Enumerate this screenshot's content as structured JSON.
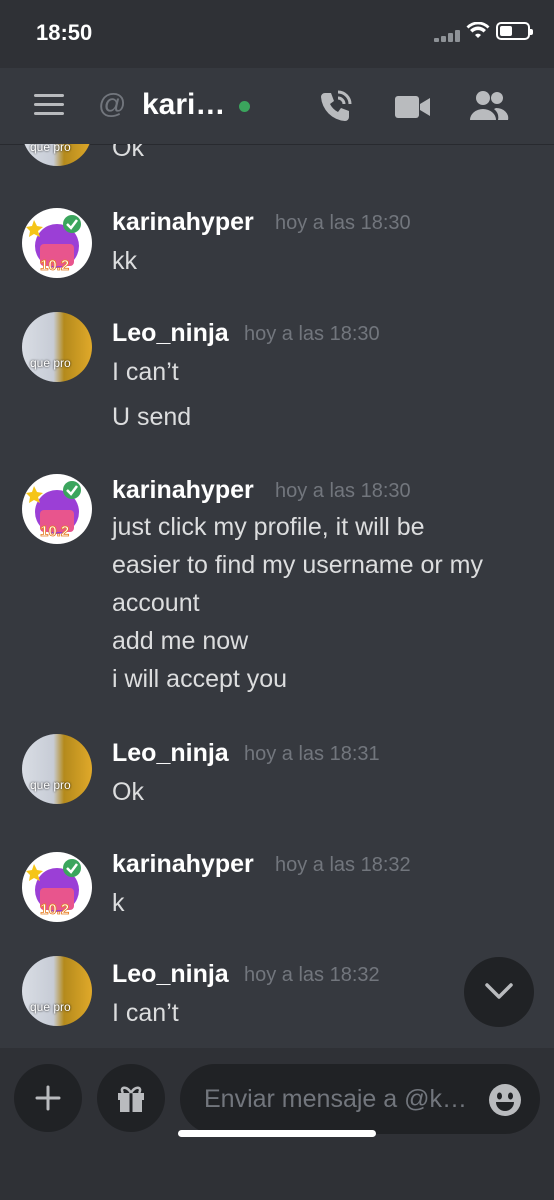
{
  "status_bar": {
    "time": "18:50"
  },
  "header": {
    "at_symbol": "@",
    "channel_name": "kari…",
    "online_color": "#3ba55d",
    "icons": [
      "menu-icon",
      "call-icon",
      "video-icon",
      "members-icon"
    ]
  },
  "messages": [
    {
      "author": "",
      "timestamp": "",
      "lines": [
        "Ok"
      ],
      "avatar_label": "que pro"
    },
    {
      "author": "karinahyper",
      "timestamp": "hoy a las 18:30",
      "lines": [
        "kk"
      ],
      "avatar_label": "10.2"
    },
    {
      "author": "Leo_ninja",
      "timestamp": "hoy a las 18:30",
      "lines": [
        "I can’t",
        "U send"
      ],
      "avatar_label": "que pro"
    },
    {
      "author": "karinahyper",
      "timestamp": "hoy a las 18:30",
      "lines": [
        "just click my profile, it will be",
        "easier to find my username or my",
        "account",
        "add me now",
        "i will accept you"
      ],
      "avatar_label": "10.2"
    },
    {
      "author": "Leo_ninja",
      "timestamp": "hoy a las 18:31",
      "lines": [
        "Ok"
      ],
      "avatar_label": "que pro"
    },
    {
      "author": "karinahyper",
      "timestamp": "hoy a las 18:32",
      "lines": [
        "k"
      ],
      "avatar_label": "10.2"
    },
    {
      "author": "Leo_ninja",
      "timestamp": "hoy a las 18:32",
      "lines": [
        "I can’t"
      ],
      "avatar_label": "que pro"
    }
  ],
  "composer": {
    "placeholder": "Enviar mensaje a @k…",
    "icons": [
      "plus-icon",
      "gift-icon",
      "emoji-icon"
    ]
  }
}
